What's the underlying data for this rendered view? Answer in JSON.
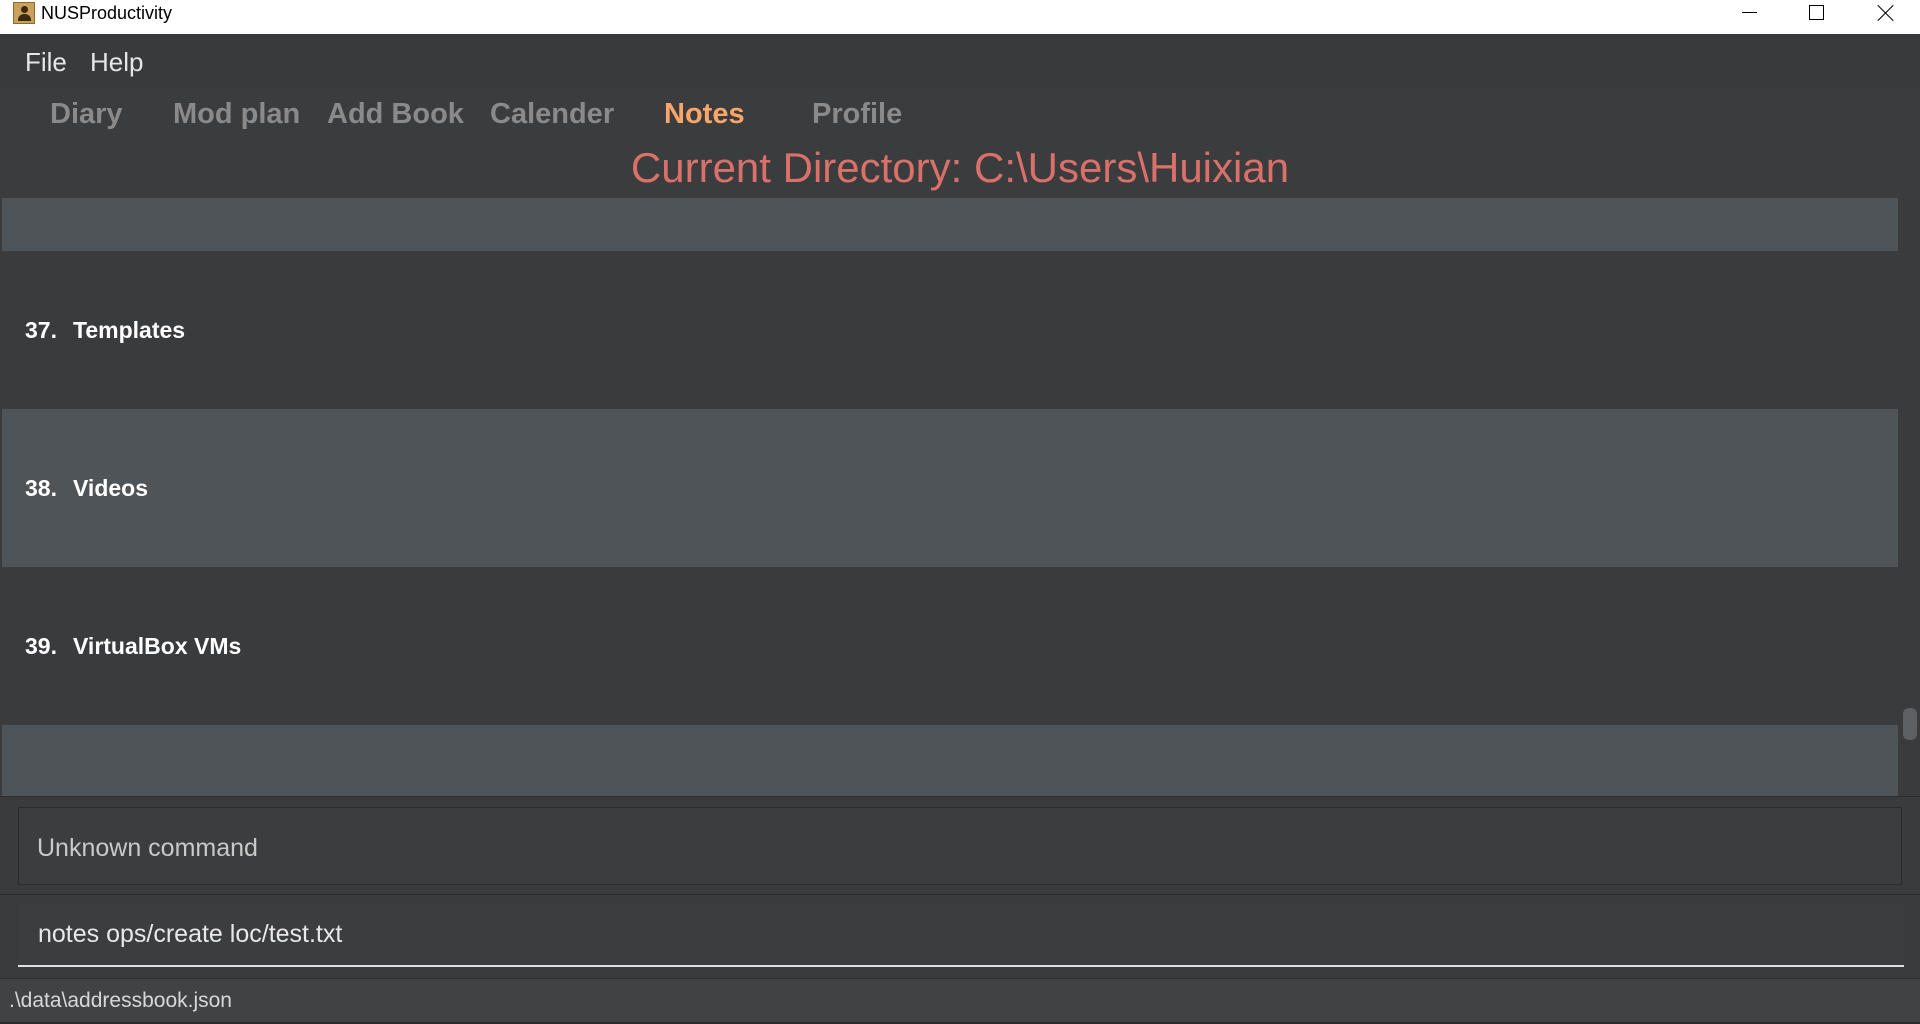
{
  "window": {
    "title": "NUSProductivity",
    "icon": "app-person-icon"
  },
  "menu": {
    "file": "File",
    "help": "Help"
  },
  "tabs": [
    {
      "label": "Diary",
      "active": false
    },
    {
      "label": "Mod plan",
      "active": false
    },
    {
      "label": "Add Book",
      "active": false
    },
    {
      "label": "Calender",
      "active": false
    },
    {
      "label": "Notes",
      "active": true
    },
    {
      "label": "Profile",
      "active": false
    }
  ],
  "notes": {
    "current_directory": "Current Directory: C:\\Users\\Huixian",
    "items": [
      {
        "index": "37.",
        "name": "Templates"
      },
      {
        "index": "38.",
        "name": "Videos"
      },
      {
        "index": "39.",
        "name": "VirtualBox VMs"
      }
    ]
  },
  "result": {
    "text": "Unknown command"
  },
  "command": {
    "value": "notes ops/create loc/test.txt"
  },
  "status": {
    "file_path": ".\\data\\addressbook.json"
  },
  "colors": {
    "active_tab": "#f9a66a",
    "directory_text": "#d9706a",
    "row_light": "#4f5458",
    "row_dark": "#3a3b3d"
  }
}
